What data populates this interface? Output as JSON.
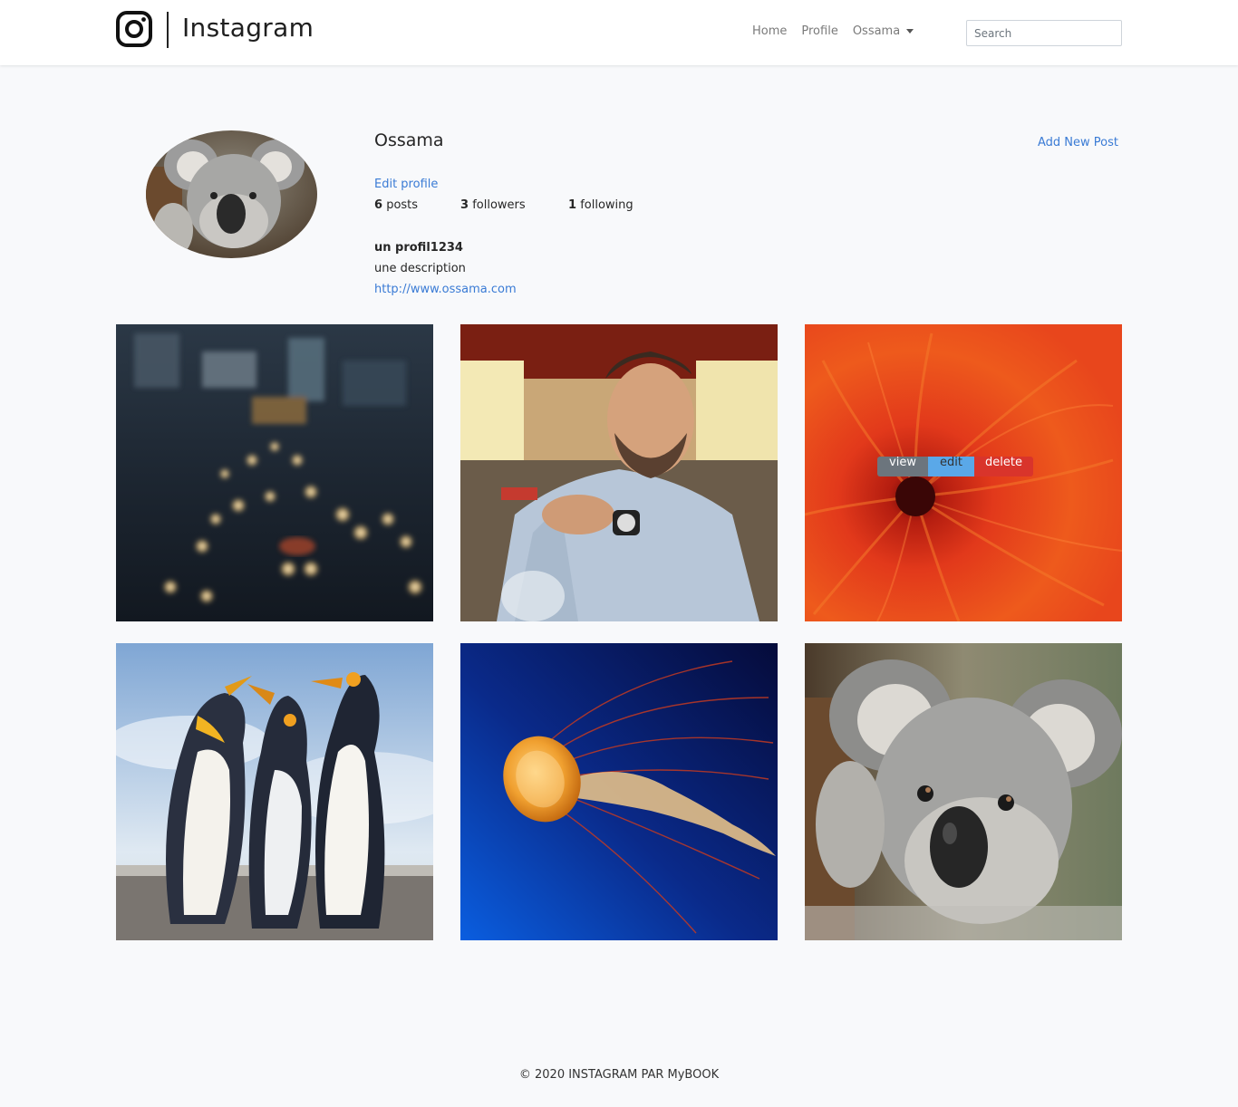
{
  "navbar": {
    "brand_name": "Instagram",
    "brand_icon": "instagram-icon",
    "links": [
      "Home",
      "Profile"
    ],
    "user_dropdown": "Ossama",
    "search_placeholder": "Search"
  },
  "profile": {
    "username": "Ossama",
    "add_new_post": "Add New Post",
    "edit_profile": "Edit profile",
    "stats": {
      "posts_count": "6",
      "posts_label": "posts",
      "followers_count": "3",
      "followers_label": "followers",
      "following_count": "1",
      "following_label": "following"
    },
    "bio_title": "un profil1234",
    "bio_description": "une description",
    "bio_url": "http://www.ossama.com"
  },
  "posts": [
    {
      "subject": "city-traffic-lights-photo"
    },
    {
      "subject": "man-portrait-photo"
    },
    {
      "subject": "red-flower-photo",
      "actions": {
        "view": "view",
        "edit": "edit",
        "delete": "delete"
      }
    },
    {
      "subject": "penguins-photo"
    },
    {
      "subject": "jellyfish-photo"
    },
    {
      "subject": "koala-photo"
    }
  ],
  "footer": {
    "text": "© 2020 INSTAGRAM PAR MyBOOK"
  }
}
